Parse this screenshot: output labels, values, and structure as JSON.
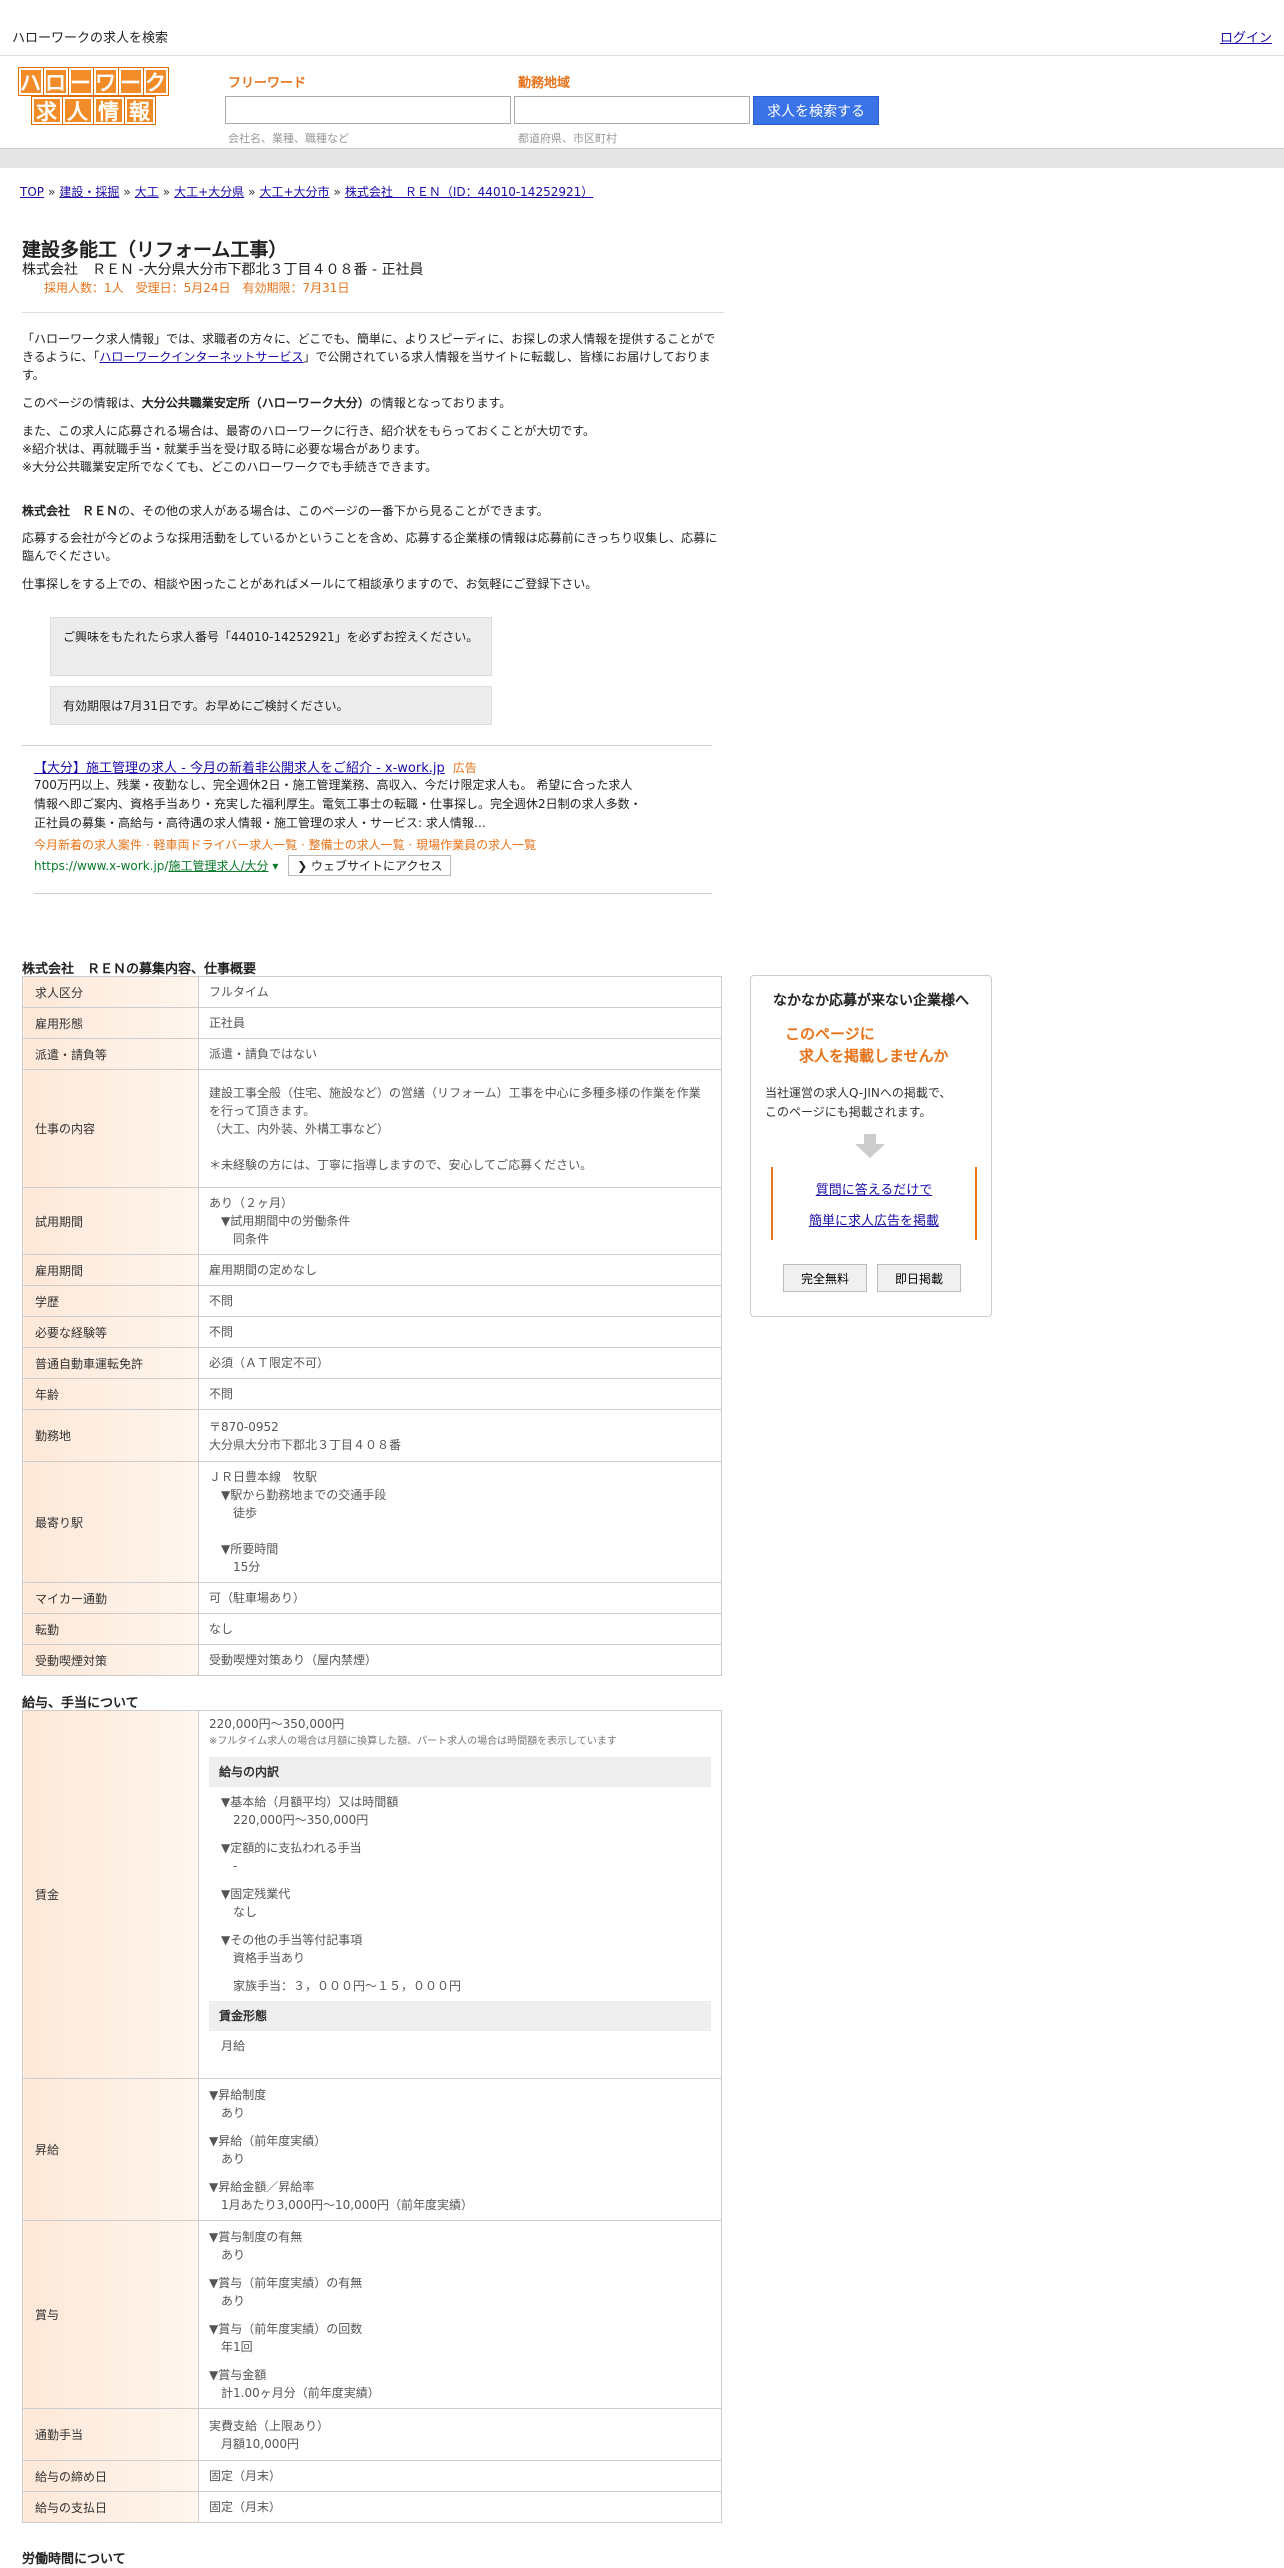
{
  "topbar": {
    "site_title": "ハローワークの求人を検索",
    "login": "ログイン"
  },
  "logo": {
    "row1": [
      "ハ",
      "ロ",
      "ー",
      "ワ",
      "ー",
      "ク"
    ],
    "row2": [
      "求",
      "人",
      "情",
      "報"
    ]
  },
  "search": {
    "freeword_label": "フリーワード",
    "freeword_hint": "会社名、業種、職種など",
    "area_label": "勤務地域",
    "area_hint": "都道府県、市区町村",
    "button": "求人を検索する"
  },
  "breadcrumb": [
    "TOP",
    "建設・採掘",
    "大工",
    "大工+大分県",
    "大工+大分市",
    "株式会社　ＲＥＮ（ID：44010-14252921）"
  ],
  "job": {
    "title": "建設多能工（リフォーム工事）",
    "subtitle": "株式会社　ＲＥＮ -大分県大分市下郡北３丁目４０８番 - 正社員",
    "meta": "採用人数：1人　受理日：5月24日　有効期限：7月31日"
  },
  "intro": {
    "p1_a": "「ハローワーク求人情報」では、求職者の方々に、どこでも、簡単に、よりスピーディに、お探しの求人情報を提供することができるように、「",
    "p1_link": "ハローワークインターネットサービス",
    "p1_b": "」で公開されている求人情報を当サイトに転載し、皆様にお届けしております。",
    "p2_a": "このページの情報は、",
    "p2_b": "大分公共職業安定所（ハローワーク大分）",
    "p2_c": "の情報となっております。",
    "p3_1": "また、この求人に応募される場合は、最寄のハローワークに行き、紹介状をもらっておくことが大切です。",
    "p3_2": "※紹介状は、再就職手当・就業手当を受け取る時に必要な場合があります。",
    "p3_3": "※大分公共職業安定所でなくても、どこのハローワークでも手続きできます。",
    "p4_a": "株式会社　ＲＥＮ",
    "p4_b": "の、その他の求人がある場合は、このページの一番下から見ることができます。",
    "p5": "応募する会社が今どのような採用活動をしているかということを含め、応募する企業様の情報は応募前にきっちり収集し、応募に臨んでください。",
    "p6": "仕事探しをする上での、相談や困ったことがあればメールにて相談承りますので、お気軽にご登録下さい。"
  },
  "notices": [
    "ご興味をもたれたら求人番号「44010-14252921」を必ずお控えください。",
    "有効期限は7月31日です。お早めにご検討ください。"
  ],
  "ad": {
    "title": "【大分】施工管理の求人 - 今月の新着非公開求人をご紹介 - x-work.jp",
    "tag": "広告",
    "desc": "700万円以上、残業・夜勤なし、完全週休2日・施工管理業務、高収入、今だけ限定求人も。 希望に合った求人情報へ即ご案内、資格手当あり・充実した福利厚生。電気工事士の転職・仕事探し。完全週休2日制の求人多数・正社員の募集・高給与・高待遇の求人情報・施工管理の求人・サービス: 求人情報…",
    "links": "今月新着の求人案件 · 軽車両ドライバー求人一覧 · 整備士の求人一覧 · 現場作業員の求人一覧",
    "url_a": "https://www.x-work.jp/",
    "url_b": "施工管理求人/大分",
    "url_c": "▾",
    "visit": "❯ ウェブサイトにアクセス"
  },
  "overview_title": "株式会社　ＲＥＮの募集内容、仕事概要",
  "overview": [
    {
      "k": "求人区分",
      "v": [
        "フルタイム"
      ]
    },
    {
      "k": "雇用形態",
      "v": [
        "正社員"
      ]
    },
    {
      "k": "派遣・請負等",
      "v": [
        "派遣・請負ではない"
      ]
    },
    {
      "k": "仕事の内容",
      "v": [
        "建設工事全般（住宅、施設など）の営繕（リフォーム）工事を中心に多種多様の作業を作業を行って頂きます。",
        "（大工、内外装、外構工事など）",
        "",
        "＊未経験の方には、丁寧に指導しますので、安心してご応募ください。"
      ]
    },
    {
      "k": "試用期間",
      "v": [
        "あり（２ヶ月）",
        "　▼試用期間中の労働条件",
        "　　同条件"
      ]
    },
    {
      "k": "雇用期間",
      "v": [
        "雇用期間の定めなし"
      ]
    },
    {
      "k": "学歴",
      "v": [
        "不問"
      ]
    },
    {
      "k": "必要な経験等",
      "v": [
        "不問"
      ]
    },
    {
      "k": "普通自動車運転免許",
      "v": [
        "必須（ＡＴ限定不可）"
      ]
    },
    {
      "k": "年齢",
      "v": [
        "不問"
      ]
    },
    {
      "k": "勤務地",
      "v": [
        "〒870-0952",
        "大分県大分市下郡北３丁目４０８番"
      ]
    },
    {
      "k": "最寄り駅",
      "v": [
        "ＪＲ日豊本線　牧駅",
        "　▼駅から勤務地までの交通手段",
        "　　徒歩",
        "",
        "　▼所要時間",
        "　　15分"
      ]
    },
    {
      "k": "マイカー通勤",
      "v": [
        "可（駐車場あり）"
      ]
    },
    {
      "k": "転勤",
      "v": [
        "なし"
      ]
    },
    {
      "k": "受動喫煙対策",
      "v": [
        "受動喫煙対策あり（屋内禁煙）"
      ]
    }
  ],
  "salary_title": "給与、手当について",
  "salary": {
    "wage_key": "賃金",
    "range": "220,000円〜350,000円",
    "note": "※フルタイム求人の場合は月額に換算した額、パート求人の場合は時間額を表示しています",
    "breakdown_title": "給与の内訳",
    "breakdown": [
      "▼基本給（月額平均）又は時間額",
      "　220,000円〜350,000円",
      "",
      "▼定額的に支払われる手当",
      "　-",
      "",
      "▼固定残業代",
      "　なし",
      "",
      "▼その他の手当等付記事項",
      "　資格手当あり",
      "",
      "　家族手当：３，０００円～１５，０００円"
    ],
    "form_title": "賃金形態",
    "form": "月給",
    "raise_key": "昇給",
    "raise": [
      "▼昇給制度",
      "　あり",
      "",
      "▼昇給（前年度実績）",
      "　あり",
      "",
      "▼昇給金額／昇給率",
      "　1月あたり3,000円〜10,000円（前年度実績）"
    ],
    "bonus_key": "賞与",
    "bonus": [
      "▼賞与制度の有無",
      "　あり",
      "",
      "▼賞与（前年度実績）の有無",
      "　あり",
      "",
      "▼賞与（前年度実績）の回数",
      "　年1回",
      "",
      "▼賞与金額",
      "　計1.00ヶ月分（前年度実績）"
    ],
    "commute_key": "通勤手当",
    "commute": [
      "実費支給（上限あり）",
      "　月額10,000円"
    ],
    "close_key": "給与の締め日",
    "close": "固定（月末）",
    "pay_key": "給与の支払日",
    "pay": "固定（月末）"
  },
  "worktime_title": "労働時間について",
  "side": {
    "title": "なかなか応募が来ない企業様へ",
    "orange_1": "このページに",
    "orange_2": "求人を掲載しませんか",
    "text_1": "当社運営の求人Q-JINへの掲載で、",
    "text_2": "このページにも掲載されます。",
    "link_1": "質問に答えるだけで",
    "link_2": "簡単に求人広告を掲載",
    "btn_1": "完全無料",
    "btn_2": "即日掲載"
  }
}
